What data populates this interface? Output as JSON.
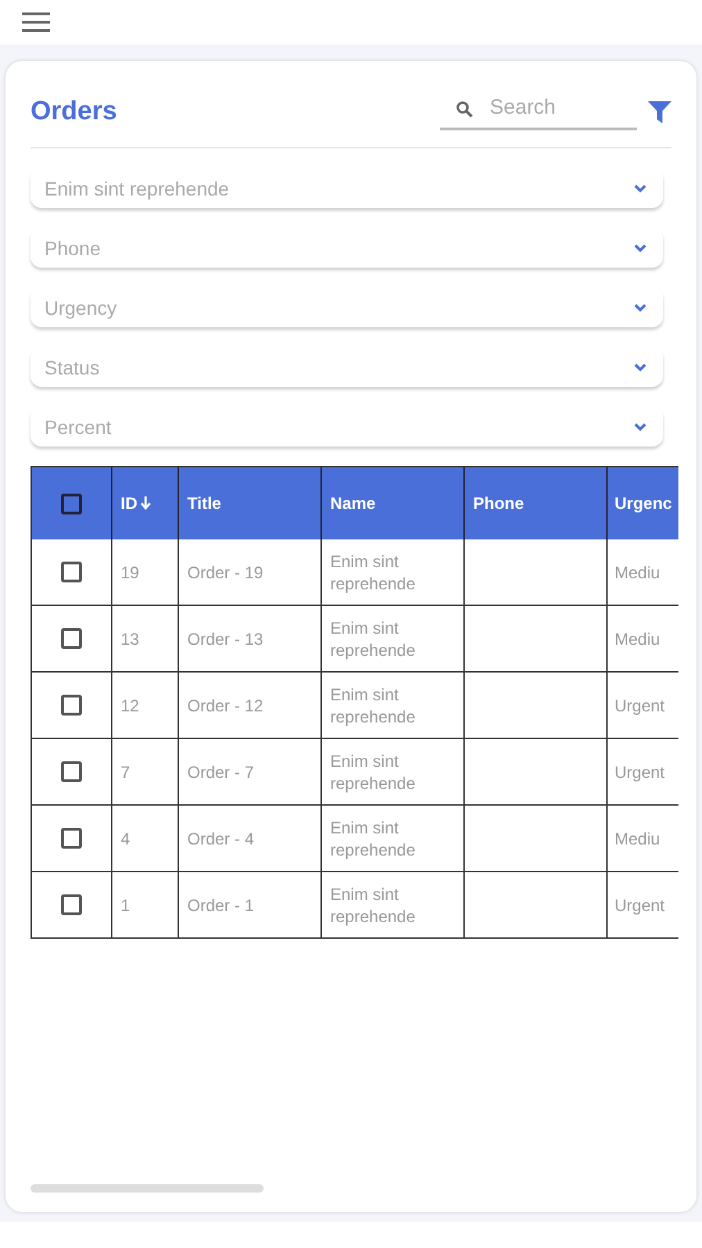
{
  "title": "Orders",
  "search": {
    "placeholder": "Search"
  },
  "filters": [
    {
      "placeholder": "Enim sint reprehende"
    },
    {
      "placeholder": "Phone"
    },
    {
      "placeholder": "Urgency"
    },
    {
      "placeholder": "Status"
    },
    {
      "placeholder": "Percent"
    }
  ],
  "table": {
    "all_checked": false,
    "columns": [
      {
        "label": "ID",
        "sorted": true
      },
      {
        "label": "Title",
        "sorted": false
      },
      {
        "label": "Name",
        "sorted": false
      },
      {
        "label": "Phone",
        "sorted": false
      },
      {
        "label": "Urgenc",
        "sorted": false
      }
    ],
    "rows": [
      {
        "checked": false,
        "cells": [
          "19",
          "Order - 19",
          "Enim sint reprehende",
          "",
          "Mediu"
        ]
      },
      {
        "checked": false,
        "cells": [
          "13",
          "Order - 13",
          "Enim sint reprehende",
          "",
          "Mediu"
        ]
      },
      {
        "checked": false,
        "cells": [
          "12",
          "Order - 12",
          "Enim sint reprehende",
          "",
          "Urgent"
        ]
      },
      {
        "checked": false,
        "cells": [
          "7",
          "Order - 7",
          "Enim sint reprehende",
          "",
          "Urgent"
        ]
      },
      {
        "checked": false,
        "cells": [
          "4",
          "Order - 4",
          "Enim sint reprehende",
          "",
          "Mediu"
        ]
      },
      {
        "checked": false,
        "cells": [
          "1",
          "Order - 1",
          "Enim sint reprehende",
          "",
          "Urgent"
        ]
      }
    ]
  }
}
